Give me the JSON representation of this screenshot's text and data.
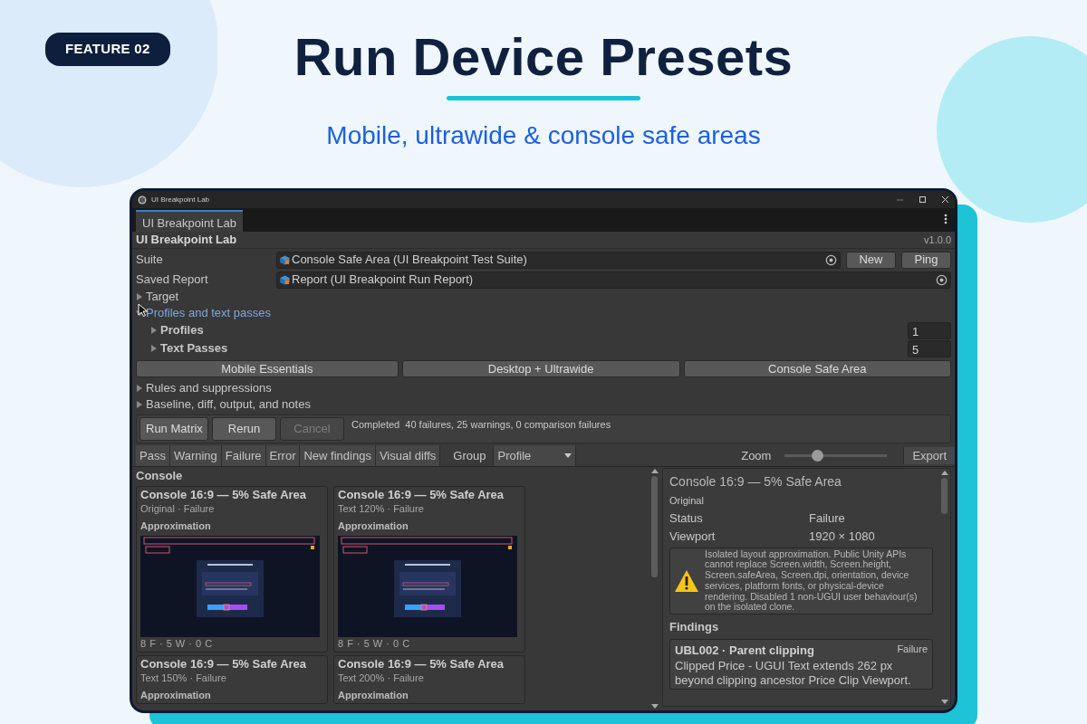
{
  "hero": {
    "badge": "FEATURE 02",
    "title": "Run Device Presets",
    "subtitle": "Mobile, ultrawide & console safe areas"
  },
  "window": {
    "title": "UI Breakpoint Lab"
  },
  "tabs": [
    {
      "label": "UI Breakpoint Lab",
      "selected": true
    }
  ],
  "header": {
    "title": "UI Breakpoint Lab",
    "version": "v1.0.0"
  },
  "fields": [
    {
      "label": "Suite",
      "value": "Console Safe Area (UI Breakpoint Test Suite)",
      "buttons": [
        "New",
        "Ping"
      ]
    },
    {
      "label": "Saved Report",
      "value": "Report (UI Breakpoint Run Report)"
    }
  ],
  "foldouts": [
    {
      "label": "Target",
      "expanded": false,
      "hovered": false
    },
    {
      "label": "Profiles and text passes",
      "expanded": true,
      "hovered": true,
      "children": [
        {
          "label": "Profiles",
          "expanded": false,
          "count": "1"
        },
        {
          "label": "Text Passes",
          "expanded": false,
          "count": "5"
        }
      ]
    }
  ],
  "preset_buttons": [
    "Mobile Essentials",
    "Desktop + Ultrawide",
    "Console Safe Area"
  ],
  "foldouts_2": [
    {
      "label": "Rules and suppressions",
      "expanded": false
    },
    {
      "label": "Baseline, diff, output, and notes",
      "expanded": false
    }
  ],
  "run_bar": {
    "buttons": [
      {
        "label": "Run Matrix",
        "disabled": false
      },
      {
        "label": "Rerun",
        "disabled": false
      },
      {
        "label": "Cancel",
        "disabled": true
      }
    ],
    "status": "Completed",
    "summary": "40 failures, 25 warnings, 0 comparison failures"
  },
  "filters": [
    "Pass",
    "Warning",
    "Failure",
    "Error",
    "New findings",
    "Visual diffs"
  ],
  "group": {
    "label": "Group",
    "value": "Profile"
  },
  "zoom": {
    "label": "Zoom",
    "level": 0.32
  },
  "export": "Export",
  "results": {
    "section": "Console",
    "cards": [
      {
        "title": "Console 16:9 — 5% Safe Area",
        "subtitle": "Original · Failure",
        "heading": "Approximation",
        "footer": "8 F · 5 W · 0 C"
      },
      {
        "title": "Console 16:9 — 5% Safe Area",
        "subtitle": "Text 120% · Failure",
        "heading": "Approximation",
        "footer": "8 F · 5 W · 0 C"
      },
      {
        "title": "Console 16:9 — 5% Safe Area",
        "subtitle": "Text 150% · Failure",
        "heading": "Approximation"
      },
      {
        "title": "Console 16:9 — 5% Safe Area",
        "subtitle": "Text 200% · Failure",
        "heading": "Approximation"
      }
    ]
  },
  "detail": {
    "title": "Console 16:9 — 5% Safe Area",
    "subtitle": "Original",
    "rows": [
      {
        "label": "Status",
        "value": "Failure"
      },
      {
        "label": "Viewport",
        "value": "1920 × 1080"
      }
    ],
    "warning": "Isolated layout approximation. Public Unity APIs cannot replace Screen.width, Screen.height, Screen.safeArea, Screen.dpi, orientation, device services, platform fonts, or physical-device rendering. Disabled 1 non-UGUI user behaviour(s) on the isolated clone.",
    "findings_heading": "Findings",
    "findings": [
      {
        "title": "UBL002 · Parent clipping",
        "severity": "Failure",
        "message": "Clipped Price - UGUI Text extends 262 px beyond clipping ancestor Price Clip Viewport."
      }
    ]
  }
}
